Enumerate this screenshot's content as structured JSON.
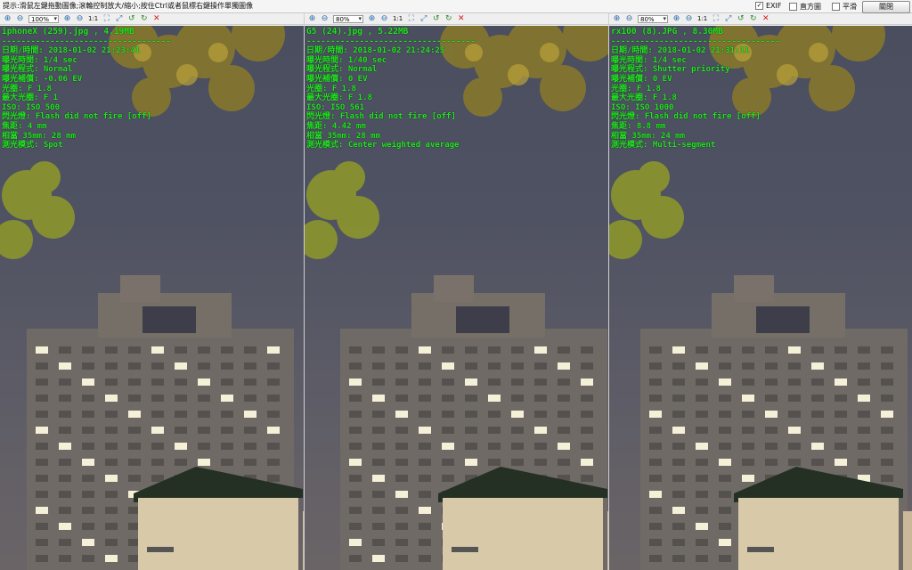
{
  "hint_text": "提示:滑鼠左鍵拖動圖像;滾輪控制放大/縮小;按住Ctrl或者鼠標右鍵操作單獨圖像",
  "options": {
    "exif": {
      "label": "EXIF",
      "checked": true
    },
    "histogram": {
      "label": "直方圖",
      "checked": false
    },
    "smooth": {
      "label": "平滑",
      "checked": false
    }
  },
  "close_label": "關閉",
  "toolbar_icons": [
    "zoom-in-icon",
    "zoom-out-icon",
    "one-to-one",
    "fit-icon",
    "rotate-left-icon",
    "rotate-right-icon",
    "delete-icon"
  ],
  "panes": [
    {
      "zoom": "100%",
      "one_to_one": "1:1",
      "title": "iphoneX (259).jpg , 4.19MB",
      "divider": "-----------------------------------",
      "lines": [
        "日期/時間: 2018-01-02 21:23:41",
        "曝光時間: 1/4 sec",
        "曝光程式: Normal",
        "曝光補償: -0.06 EV",
        "光圈: F 1.8",
        "最大光圈: F 1",
        "ISO: ISO 500",
        "閃光燈: Flash did not fire [off]",
        "焦距: 4 mm",
        "相當 35mm: 28 mm",
        "測光模式: Spot"
      ]
    },
    {
      "zoom": "80%",
      "one_to_one": "1:1",
      "title": "G5 (24).jpg , 5.22MB",
      "divider": "-----------------------------------",
      "lines": [
        "日期/時間: 2018-01-02 21:24:25",
        "曝光時間: 1/40 sec",
        "曝光程式: Normal",
        "曝光補償: 0 EV",
        "光圈: F 1.8",
        "最大光圈: F 1.8",
        "ISO: ISO 561",
        "閃光燈: Flash did not fire [off]",
        "焦距: 4.42 mm",
        "相當 35mm: 28 mm",
        "測光模式: Center weighted average"
      ]
    },
    {
      "zoom": "80%",
      "one_to_one": "1:1",
      "title": "rx100 (8).JPG , 8.30MB",
      "divider": "-----------------------------------",
      "lines": [
        "日期/時間: 2018-01-02 21:31:11",
        "曝光時間: 1/4 sec",
        "曝光程式: Shutter priority",
        "曝光補償: 0 EV",
        "光圈: F 1.8",
        "最大光圈: F 1.8",
        "ISO: ISO 1000",
        "閃光燈: Flash did not fire [off]",
        "焦距: 8.8 mm",
        "相當 35mm: 24 mm",
        "測光模式: Multi-segment"
      ]
    }
  ]
}
